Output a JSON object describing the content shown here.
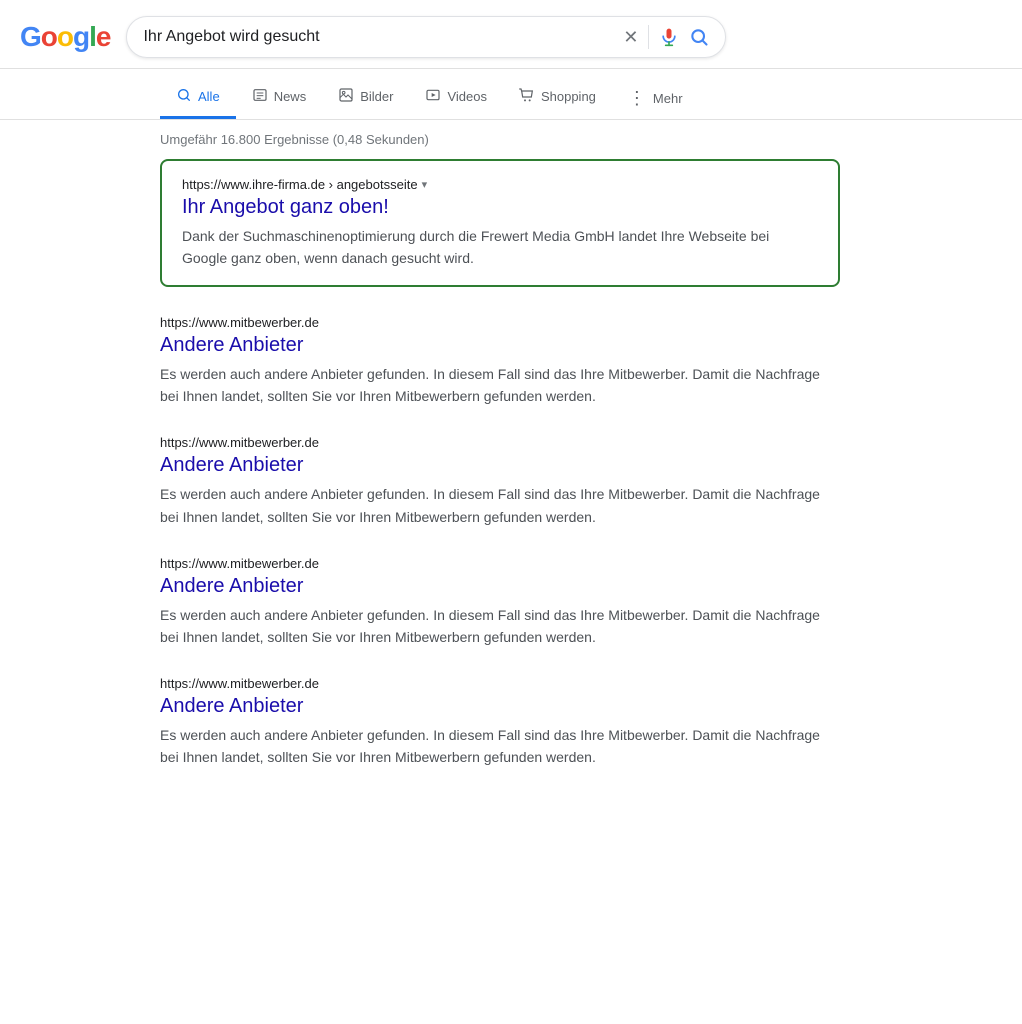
{
  "header": {
    "logo_letters": [
      {
        "letter": "G",
        "color_class": "g-blue"
      },
      {
        "letter": "o",
        "color_class": "g-red"
      },
      {
        "letter": "o",
        "color_class": "g-yellow"
      },
      {
        "letter": "g",
        "color_class": "g-blue"
      },
      {
        "letter": "l",
        "color_class": "g-green"
      },
      {
        "letter": "e",
        "color_class": "g-red"
      }
    ],
    "search_query": "Ihr Angebot wird gesucht",
    "clear_icon": "✕",
    "mic_icon": "🎤",
    "search_icon": "🔍"
  },
  "nav": {
    "tabs": [
      {
        "id": "alle",
        "label": "Alle",
        "active": true,
        "icon": "🔍"
      },
      {
        "id": "news",
        "label": "News",
        "active": false,
        "icon": "📰"
      },
      {
        "id": "bilder",
        "label": "Bilder",
        "active": false,
        "icon": "🖼"
      },
      {
        "id": "videos",
        "label": "Videos",
        "active": false,
        "icon": "▶"
      },
      {
        "id": "shopping",
        "label": "Shopping",
        "active": false,
        "icon": "🏷"
      },
      {
        "id": "mehr",
        "label": "Mehr",
        "active": false,
        "icon": "⋮"
      }
    ]
  },
  "results_info": "Umgefähr 16.800 Ergebnisse (0,48 Sekunden)",
  "featured": {
    "url": "https://www.ihre-firma.de › angebotsseite",
    "title": "Ihr Angebot ganz oben!",
    "snippet": "Dank der Suchmaschinenoptimierung durch die Frewert Media GmbH landet Ihre Webseite bei Google ganz oben, wenn danach gesucht wird."
  },
  "results": [
    {
      "url": "https://www.mitbewerber.de",
      "title": "Andere Anbieter",
      "snippet": "Es werden auch andere Anbieter gefunden. In diesem Fall sind das Ihre Mitbewerber. Damit die Nachfrage bei Ihnen landet, sollten Sie vor Ihren Mitbewerbern gefunden werden."
    },
    {
      "url": "https://www.mitbewerber.de",
      "title": "Andere Anbieter",
      "snippet": "Es werden auch andere Anbieter gefunden. In diesem Fall sind das Ihre Mitbewerber. Damit die Nachfrage bei Ihnen landet, sollten Sie vor Ihren Mitbewerbern gefunden werden."
    },
    {
      "url": "https://www.mitbewerber.de",
      "title": "Andere Anbieter",
      "snippet": "Es werden auch andere Anbieter gefunden. In diesem Fall sind das Ihre Mitbewerber. Damit die Nachfrage bei Ihnen landet, sollten Sie vor Ihren Mitbewerbern gefunden werden."
    },
    {
      "url": "https://www.mitbewerber.de",
      "title": "Andere Anbieter",
      "snippet": "Es werden auch andere Anbieter gefunden. In diesem Fall sind das Ihre Mitbewerber. Damit die Nachfrage bei Ihnen landet, sollten Sie vor Ihren Mitbewerbern gefunden werden."
    }
  ]
}
